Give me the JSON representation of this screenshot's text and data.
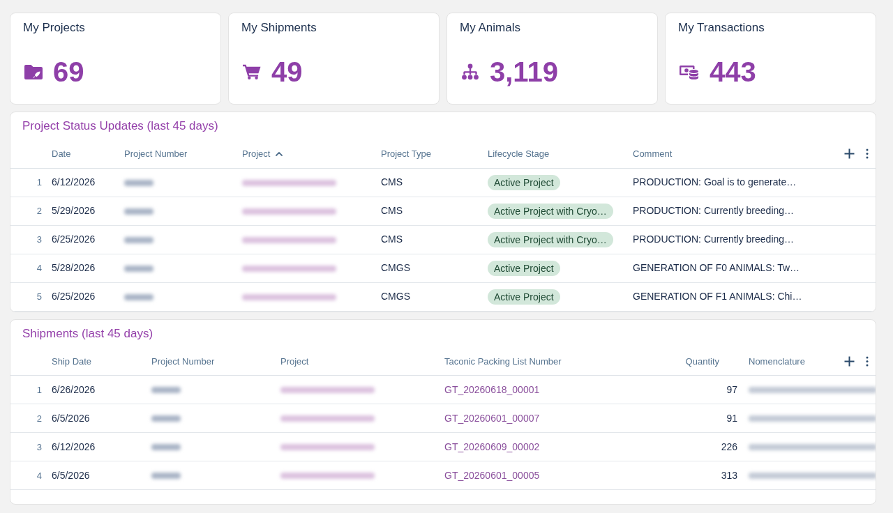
{
  "stats": [
    {
      "kind": "projects",
      "title": "My Projects",
      "value": "69"
    },
    {
      "kind": "shipments",
      "title": "My Shipments",
      "value": "49"
    },
    {
      "kind": "animals",
      "title": "My Animals",
      "value": "3,119"
    },
    {
      "kind": "transactions",
      "title": "My Transactions",
      "value": "443"
    }
  ],
  "tables": [
    {
      "title": "Project Status Updates (last 45 days)",
      "columns": [
        {
          "label": "Date",
          "sorted": false
        },
        {
          "label": "Project Number",
          "sorted": false
        },
        {
          "label": "Project",
          "sorted": true
        },
        {
          "label": "Project Type",
          "sorted": false
        },
        {
          "label": "Lifecycle Stage",
          "sorted": false
        },
        {
          "label": "Comment",
          "sorted": false
        }
      ],
      "rows": [
        {
          "index": "1",
          "cells": [
            {
              "kind": "text",
              "text": "6/12/2026"
            },
            {
              "kind": "blurred"
            },
            {
              "kind": "blurred_link"
            },
            {
              "kind": "text",
              "text": "CMS"
            },
            {
              "kind": "badge",
              "text": "Active Project"
            },
            {
              "kind": "text",
              "text": "PRODUCTION: Goal is to generate…"
            }
          ]
        },
        {
          "index": "2",
          "cells": [
            {
              "kind": "text",
              "text": "5/29/2026"
            },
            {
              "kind": "blurred"
            },
            {
              "kind": "blurred_link"
            },
            {
              "kind": "text",
              "text": "CMS"
            },
            {
              "kind": "badge",
              "text": "Active Project with Cryo…"
            },
            {
              "kind": "text",
              "text": "PRODUCTION: Currently breeding…"
            }
          ]
        },
        {
          "index": "3",
          "cells": [
            {
              "kind": "text",
              "text": "6/25/2026"
            },
            {
              "kind": "blurred"
            },
            {
              "kind": "blurred_link"
            },
            {
              "kind": "text",
              "text": "CMS"
            },
            {
              "kind": "badge",
              "text": "Active Project with Cryo…"
            },
            {
              "kind": "text",
              "text": "PRODUCTION: Currently breeding…"
            }
          ]
        },
        {
          "index": "4",
          "cells": [
            {
              "kind": "text",
              "text": "5/28/2026"
            },
            {
              "kind": "blurred"
            },
            {
              "kind": "blurred_link"
            },
            {
              "kind": "text",
              "text": "CMGS"
            },
            {
              "kind": "badge",
              "text": "Active Project"
            },
            {
              "kind": "text",
              "text": "GENERATION OF F0 ANIMALS: Tw…"
            }
          ]
        },
        {
          "index": "5",
          "cells": [
            {
              "kind": "text",
              "text": "6/25/2026"
            },
            {
              "kind": "blurred"
            },
            {
              "kind": "blurred_link"
            },
            {
              "kind": "text",
              "text": "CMGS"
            },
            {
              "kind": "badge",
              "text": "Active Project"
            },
            {
              "kind": "text",
              "text": "GENERATION OF F1 ANIMALS: Chi…"
            }
          ]
        }
      ]
    },
    {
      "title": "Shipments (last 45 days)",
      "columns": [
        {
          "label": "Ship Date",
          "kind": "text"
        },
        {
          "label": "Project Number",
          "kind": "text"
        },
        {
          "label": "Project",
          "kind": "text"
        },
        {
          "label": "Taconic Packing List Number",
          "kind": "text"
        },
        {
          "label": "Quantity",
          "kind": "number"
        },
        {
          "label": "Nomenclature",
          "kind": "text"
        }
      ],
      "rows": [
        {
          "index": "1",
          "cells": [
            {
              "kind": "text",
              "text": "6/26/2026"
            },
            {
              "kind": "blurred"
            },
            {
              "kind": "blurred_link"
            },
            {
              "kind": "link",
              "text": "GT_20260618_00001"
            },
            {
              "kind": "number",
              "text": "97"
            },
            {
              "kind": "blurred_wide"
            }
          ]
        },
        {
          "index": "2",
          "cells": [
            {
              "kind": "text",
              "text": "6/5/2026"
            },
            {
              "kind": "blurred"
            },
            {
              "kind": "blurred_link"
            },
            {
              "kind": "link",
              "text": "GT_20260601_00007"
            },
            {
              "kind": "number",
              "text": "91"
            },
            {
              "kind": "blurred_wide"
            }
          ]
        },
        {
          "index": "3",
          "cells": [
            {
              "kind": "text",
              "text": "6/12/2026"
            },
            {
              "kind": "blurred"
            },
            {
              "kind": "blurred_link"
            },
            {
              "kind": "link",
              "text": "GT_20260609_00002"
            },
            {
              "kind": "number",
              "text": "226"
            },
            {
              "kind": "blurred_wide"
            }
          ]
        },
        {
          "index": "4",
          "cells": [
            {
              "kind": "text",
              "text": "6/5/2026"
            },
            {
              "kind": "blurred"
            },
            {
              "kind": "blurred_link"
            },
            {
              "kind": "link",
              "text": "GT_20260601_00005"
            },
            {
              "kind": "number",
              "text": "313"
            },
            {
              "kind": "blurred_wide"
            }
          ]
        }
      ]
    }
  ]
}
